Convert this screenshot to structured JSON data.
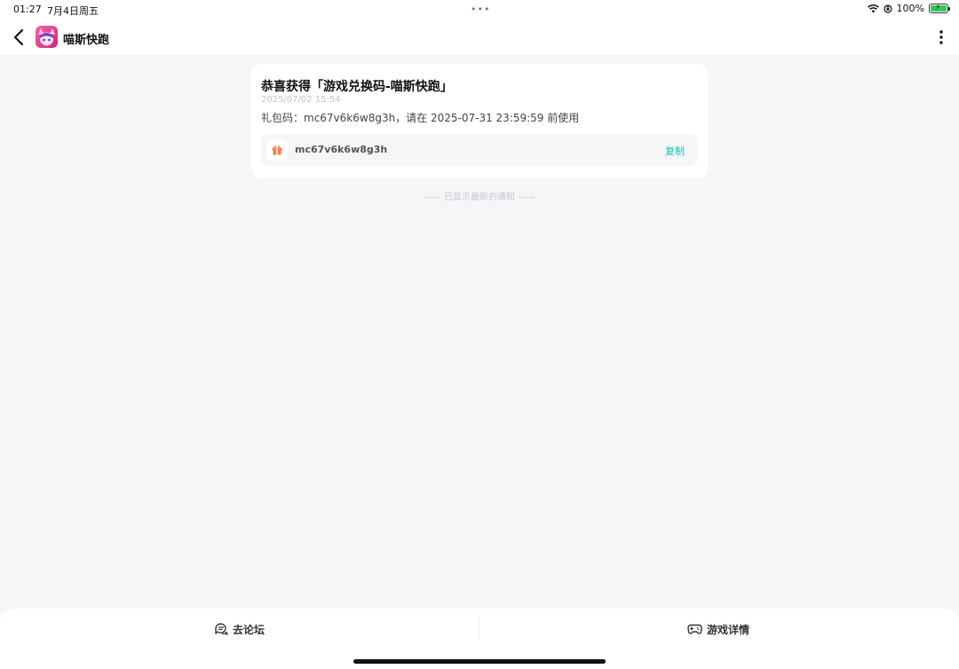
{
  "status_bar": {
    "time": "01:27",
    "date": "7月4日周五",
    "dots": "•••",
    "battery_percent": "100%",
    "battery_level": 1.0
  },
  "nav": {
    "title": "喵斯快跑",
    "back_icon": "chevron-left-icon",
    "more_icon": "more-vertical-icon"
  },
  "notification": {
    "title": "恭喜获得「游戏兑换码-喵斯快跑」",
    "time": "2025/07/02 15:54",
    "description": "礼包码：mc67v6k6w8g3h，请在 2025-07-31 23:59:59 前使用",
    "code": "mc67v6k6w8g3h",
    "copy_label": "复制",
    "gift_icon": "gift-icon"
  },
  "footer_note": "—— 已显示最新的通知 ——",
  "bottom_bar": {
    "forum_label": "去论坛",
    "detail_label": "游戏详情"
  },
  "colors": {
    "accent": "#16c1b5",
    "gift": "#ff7a45",
    "background": "#f5f6f8"
  }
}
